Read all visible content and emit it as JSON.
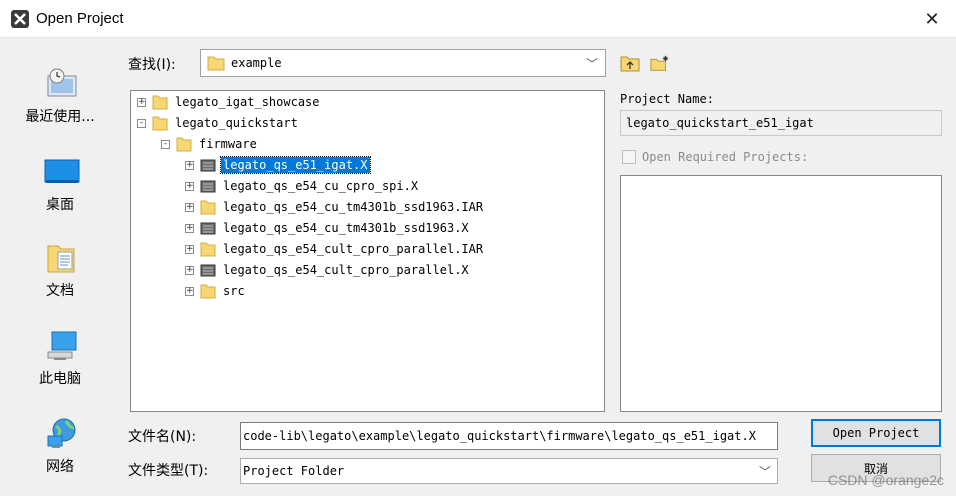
{
  "window": {
    "title": "Open Project"
  },
  "places": [
    {
      "label": "最近使用...",
      "icon": "recent-places-icon"
    },
    {
      "label": "桌面",
      "icon": "desktop-icon"
    },
    {
      "label": "文档",
      "icon": "documents-icon"
    },
    {
      "label": "此电脑",
      "icon": "this-pc-icon"
    },
    {
      "label": "网络",
      "icon": "network-icon"
    }
  ],
  "look_in": {
    "label": "查找(I):",
    "value": "example"
  },
  "tree": [
    {
      "name": "legato_igat_showcase",
      "type": "folder",
      "level": 0,
      "expander": "+"
    },
    {
      "name": "legato_quickstart",
      "type": "folder",
      "level": 0,
      "expander": "-"
    },
    {
      "name": "firmware",
      "type": "folder",
      "level": 1,
      "expander": "-"
    },
    {
      "name": "legato_qs_e51_igat.X",
      "type": "project",
      "level": 2,
      "expander": "+",
      "selected": true
    },
    {
      "name": "legato_qs_e54_cu_cpro_spi.X",
      "type": "project",
      "level": 2,
      "expander": "+"
    },
    {
      "name": "legato_qs_e54_cu_tm4301b_ssd1963.IAR",
      "type": "folder",
      "level": 2,
      "expander": "+"
    },
    {
      "name": "legato_qs_e54_cu_tm4301b_ssd1963.X",
      "type": "project",
      "level": 2,
      "expander": "+"
    },
    {
      "name": "legato_qs_e54_cult_cpro_parallel.IAR",
      "type": "folder",
      "level": 2,
      "expander": "+"
    },
    {
      "name": "legato_qs_e54_cult_cpro_parallel.X",
      "type": "project",
      "level": 2,
      "expander": "+"
    },
    {
      "name": "src",
      "type": "folder",
      "level": 2,
      "expander": "+"
    }
  ],
  "project_name": {
    "label": "Project Name:",
    "value": "legato_quickstart_e51_igat"
  },
  "open_required": {
    "label": "Open Required Projects:",
    "checked": false
  },
  "file_name": {
    "label": "文件名(N):",
    "value": "code-lib\\legato\\example\\legato_quickstart\\firmware\\legato_qs_e51_igat.X"
  },
  "file_type": {
    "label": "文件类型(T):",
    "value": "Project Folder"
  },
  "buttons": {
    "open": "Open Project",
    "cancel": "取消"
  },
  "watermark": "CSDN @orange2c",
  "colors": {
    "selection": "#0078d7",
    "folder": "#f7d774",
    "dialog_bg": "#f0f0f0"
  }
}
